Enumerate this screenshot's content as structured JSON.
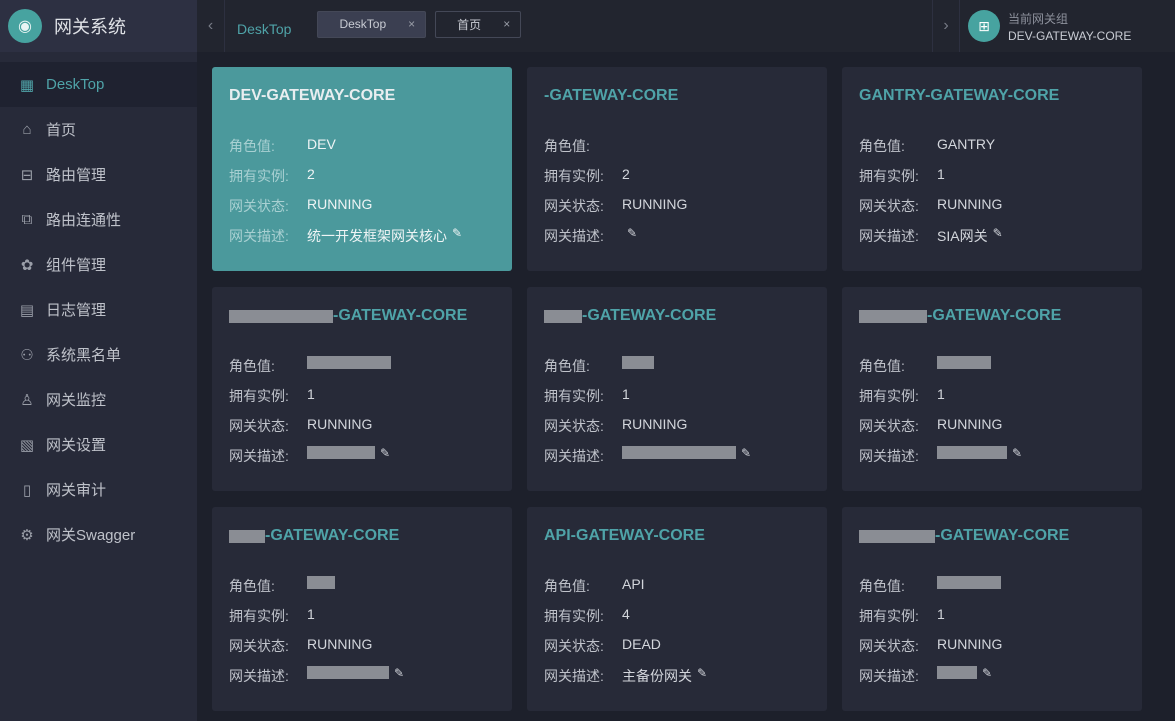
{
  "app": {
    "title": "网关系统"
  },
  "sidebar": {
    "items": [
      {
        "label": "DeskTop",
        "icon": "grid-icon",
        "glyph": "▦"
      },
      {
        "label": "首页",
        "icon": "home-icon",
        "glyph": "⌂"
      },
      {
        "label": "路由管理",
        "icon": "router-icon",
        "glyph": "⊟"
      },
      {
        "label": "路由连通性",
        "icon": "connectivity-icon",
        "glyph": "⧉"
      },
      {
        "label": "组件管理",
        "icon": "puzzle-icon",
        "glyph": "✿"
      },
      {
        "label": "日志管理",
        "icon": "log-icon",
        "glyph": "▤"
      },
      {
        "label": "系统黑名单",
        "icon": "user-block-icon",
        "glyph": "⚇"
      },
      {
        "label": "网关监控",
        "icon": "stamp-icon",
        "glyph": "♙"
      },
      {
        "label": "网关设置",
        "icon": "chart-icon",
        "glyph": "▧"
      },
      {
        "label": "网关审计",
        "icon": "audit-icon",
        "glyph": "▯"
      },
      {
        "label": "网关Swagger",
        "icon": "gear-icon",
        "glyph": "⚙"
      }
    ]
  },
  "header": {
    "breadcrumb": "DeskTop",
    "tabs": [
      {
        "label": "DeskTop"
      },
      {
        "label": "首页"
      }
    ],
    "close": "×",
    "prev": "‹",
    "next": "›",
    "group_label": "当前网关组",
    "group_value": "DEV-GATEWAY-CORE"
  },
  "labels": {
    "role": "角色值:",
    "instances": "拥有实例:",
    "status": "网关状态:",
    "desc": "网关描述:",
    "edit": "✎"
  },
  "cards": [
    {
      "title": "DEV-GATEWAY-CORE",
      "role": "DEV",
      "instances": "2",
      "status": "RUNNING",
      "desc": "统一开发框架网关核心"
    },
    {
      "title": "-GATEWAY-CORE",
      "title_redacted": true,
      "role": "",
      "instances": "2",
      "status": "RUNNING",
      "desc": ""
    },
    {
      "title": "GANTRY-GATEWAY-CORE",
      "role": "GANTRY",
      "instances": "1",
      "status": "RUNNING",
      "desc": "SIA网关"
    },
    {
      "title": "-GATEWAY-CORE",
      "title_redacted": true,
      "role": "",
      "instances": "1",
      "status": "RUNNING",
      "desc": ""
    },
    {
      "title": "-GATEWAY-CORE",
      "title_redacted": true,
      "role": "",
      "instances": "1",
      "status": "RUNNING",
      "desc": ""
    },
    {
      "title": "-GATEWAY-CORE",
      "title_redacted": true,
      "role": "",
      "instances": "1",
      "status": "RUNNING",
      "desc": ""
    },
    {
      "title": "-GATEWAY-CORE",
      "title_redacted": true,
      "role": "",
      "instances": "1",
      "status": "RUNNING",
      "desc": ""
    },
    {
      "title": "API-GATEWAY-CORE",
      "role": "API",
      "instances": "4",
      "status": "DEAD",
      "desc": "主备份网关"
    },
    {
      "title": "-GATEWAY-CORE",
      "title_redacted": true,
      "role": "",
      "instances": "1",
      "status": "RUNNING",
      "desc": ""
    }
  ]
}
